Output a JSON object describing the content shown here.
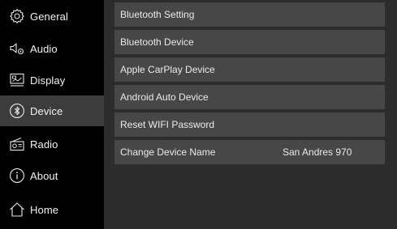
{
  "sidebar": {
    "items": [
      {
        "label": "General",
        "icon": "gear-icon"
      },
      {
        "label": "Audio",
        "icon": "speaker-icon"
      },
      {
        "label": "Display",
        "icon": "display-icon"
      },
      {
        "label": "Device",
        "icon": "bluetooth-icon",
        "active": true
      },
      {
        "label": "Radio",
        "icon": "radio-icon"
      },
      {
        "label": "About",
        "icon": "info-icon"
      },
      {
        "label": "Home",
        "icon": "home-icon"
      }
    ]
  },
  "main": {
    "rows": [
      {
        "label": "Bluetooth Setting"
      },
      {
        "label": "Bluetooth Device"
      },
      {
        "label": "Apple CarPlay Device"
      },
      {
        "label": "Android Auto Device"
      },
      {
        "label": "Reset WIFI Password"
      },
      {
        "label": "Change Device Name",
        "value": "San Andres 970"
      }
    ]
  },
  "colors": {
    "background": "#000000",
    "panel": "#2c2c2c",
    "row": "#474747",
    "active_nav": "#3c3c3c",
    "text": "#f2f2f2"
  }
}
